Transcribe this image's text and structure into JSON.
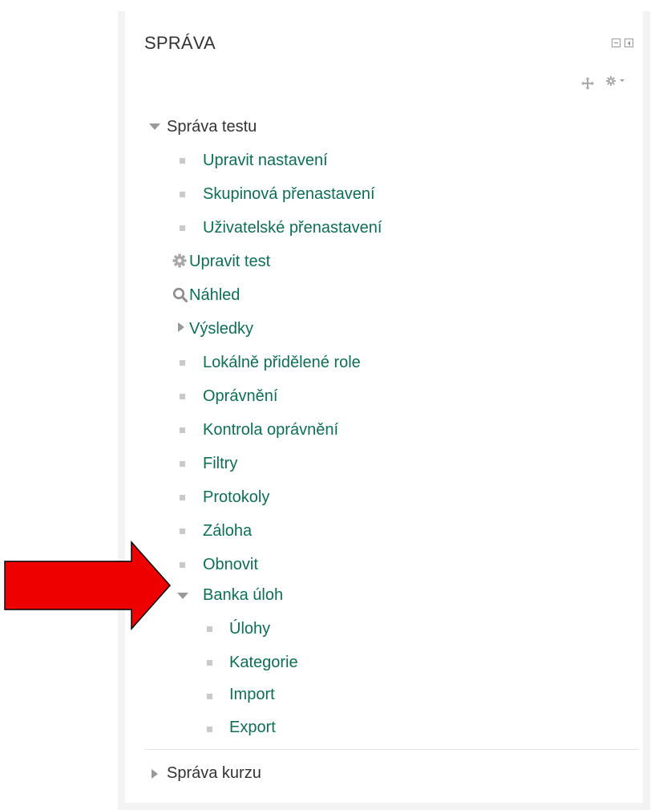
{
  "block": {
    "title": "SPRÁVA"
  },
  "quiz_admin": {
    "label": "Správa testu",
    "items": [
      {
        "label": "Upravit nastavení",
        "icon": "square-bullet"
      },
      {
        "label": "Skupinová přenastavení",
        "icon": "square-bullet"
      },
      {
        "label": "Uživatelské přenastavení",
        "icon": "square-bullet"
      },
      {
        "label": "Upravit test",
        "icon": "gear-icon"
      },
      {
        "label": "Náhled",
        "icon": "magnifier-icon"
      },
      {
        "label": "Výsledky",
        "icon": "collapsed-triangle"
      },
      {
        "label": "Lokálně přidělené role",
        "icon": "square-bullet"
      },
      {
        "label": "Oprávnění",
        "icon": "square-bullet"
      },
      {
        "label": "Kontrola oprávnění",
        "icon": "square-bullet"
      },
      {
        "label": "Filtry",
        "icon": "square-bullet"
      },
      {
        "label": "Protokoly",
        "icon": "square-bullet"
      },
      {
        "label": "Záloha",
        "icon": "square-bullet"
      },
      {
        "label": "Obnovit",
        "icon": "square-bullet"
      }
    ],
    "question_bank": {
      "label": "Banka úloh",
      "items": [
        {
          "label": "Úlohy"
        },
        {
          "label": "Kategorie"
        },
        {
          "label": "Import"
        },
        {
          "label": "Export"
        }
      ]
    }
  },
  "course_admin": {
    "label": "Správa kurzu"
  },
  "colors": {
    "link": "#0f6e52",
    "text": "#333333",
    "bullet": "#c9c9c9",
    "arrow": "#ee0000"
  }
}
